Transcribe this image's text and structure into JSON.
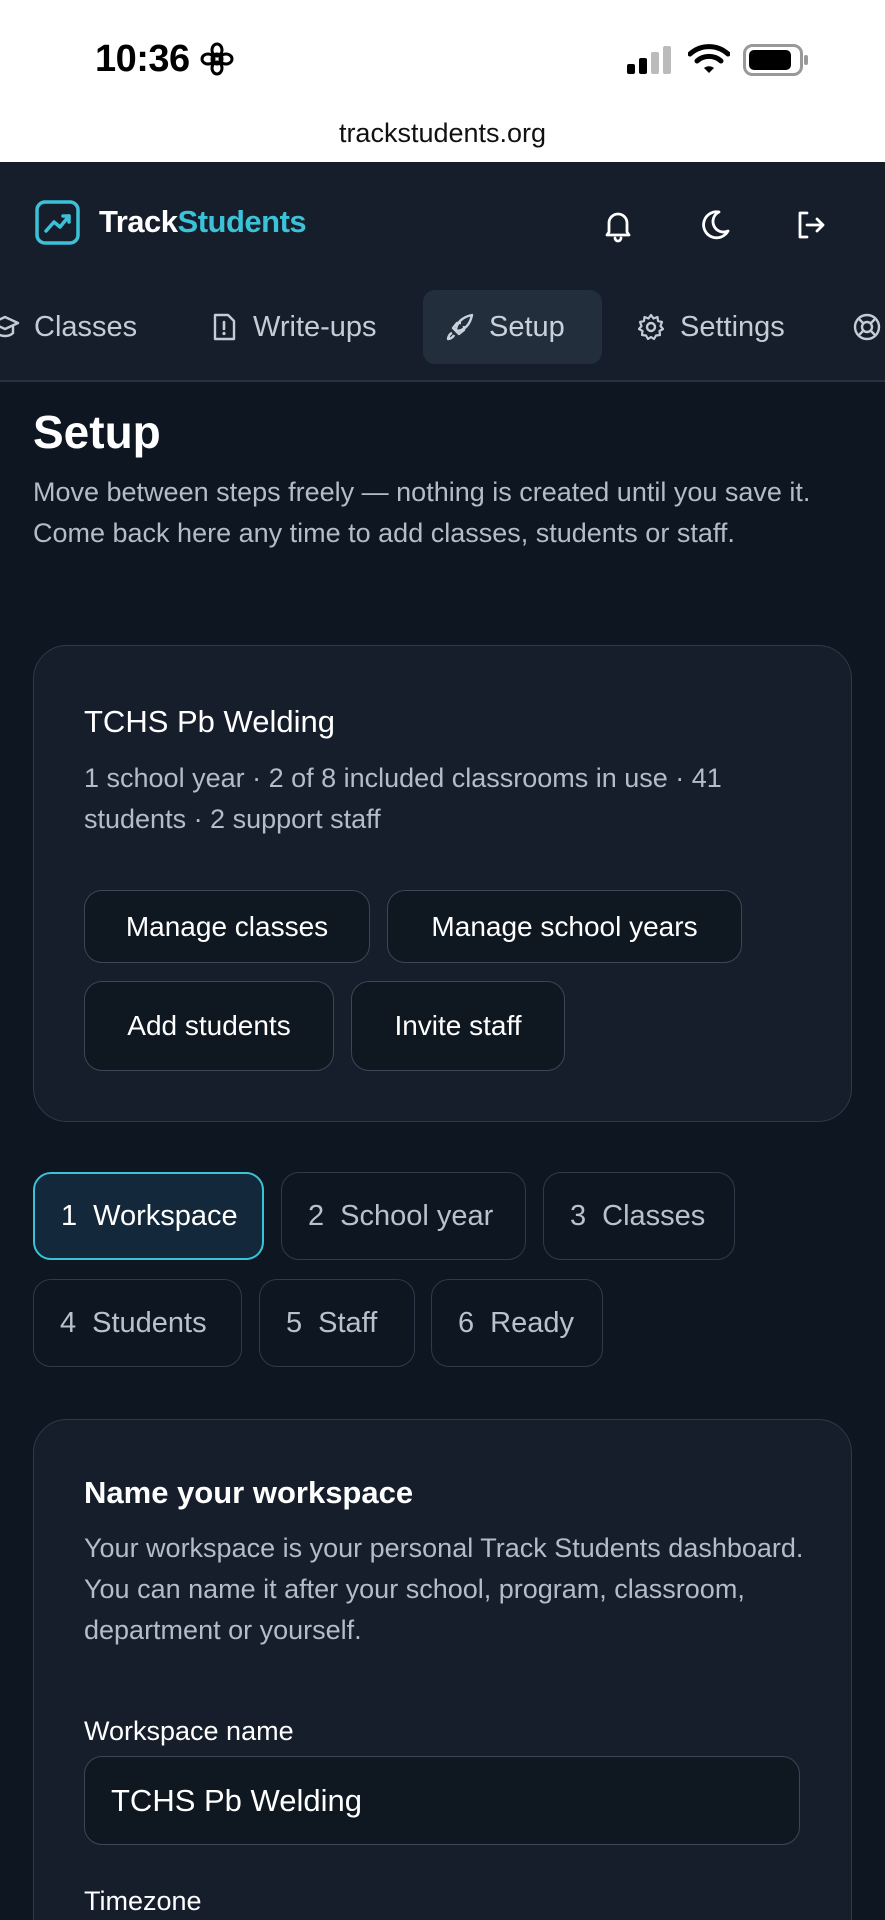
{
  "status_bar": {
    "time": "10:36",
    "url": "trackstudents.org"
  },
  "header": {
    "brand_part1": "Track",
    "brand_part2": "Students",
    "accent_color": "#3cc2d8",
    "icons": [
      "bell-icon",
      "moon-icon",
      "sign-out-icon"
    ]
  },
  "tabs": [
    {
      "label": "Classes",
      "icon": "graduation-cap-icon"
    },
    {
      "label": "Write-ups",
      "icon": "alert-file-icon"
    },
    {
      "label": "Setup",
      "icon": "rocket-icon",
      "active": true
    },
    {
      "label": "Settings",
      "icon": "gear-icon"
    },
    {
      "label": "",
      "icon": "lifebuoy-icon"
    }
  ],
  "page": {
    "title": "Setup",
    "description": "Move between steps freely — nothing is created until you save it. Come back here any time to add classes, students or staff."
  },
  "summary": {
    "workspace_name": "TCHS Pb Welding",
    "stats": "1 school year · 2 of 8 included classrooms in use · 41 students · 2 support staff",
    "buttons": {
      "manage_classes": "Manage classes",
      "manage_school_years": "Manage school years",
      "add_students": "Add students",
      "invite_staff": "Invite staff"
    }
  },
  "steps": [
    {
      "num": "1",
      "label": "Workspace",
      "active": true
    },
    {
      "num": "2",
      "label": "School year"
    },
    {
      "num": "3",
      "label": "Classes"
    },
    {
      "num": "4",
      "label": "Students"
    },
    {
      "num": "5",
      "label": "Staff"
    },
    {
      "num": "6",
      "label": "Ready"
    }
  ],
  "form": {
    "title": "Name your workspace",
    "description": "Your workspace is your personal Track Students dashboard. You can name it after your school, program, classroom, department or yourself.",
    "workspace_label": "Workspace name",
    "workspace_value": "TCHS Pb Welding",
    "timezone_label": "Timezone"
  }
}
